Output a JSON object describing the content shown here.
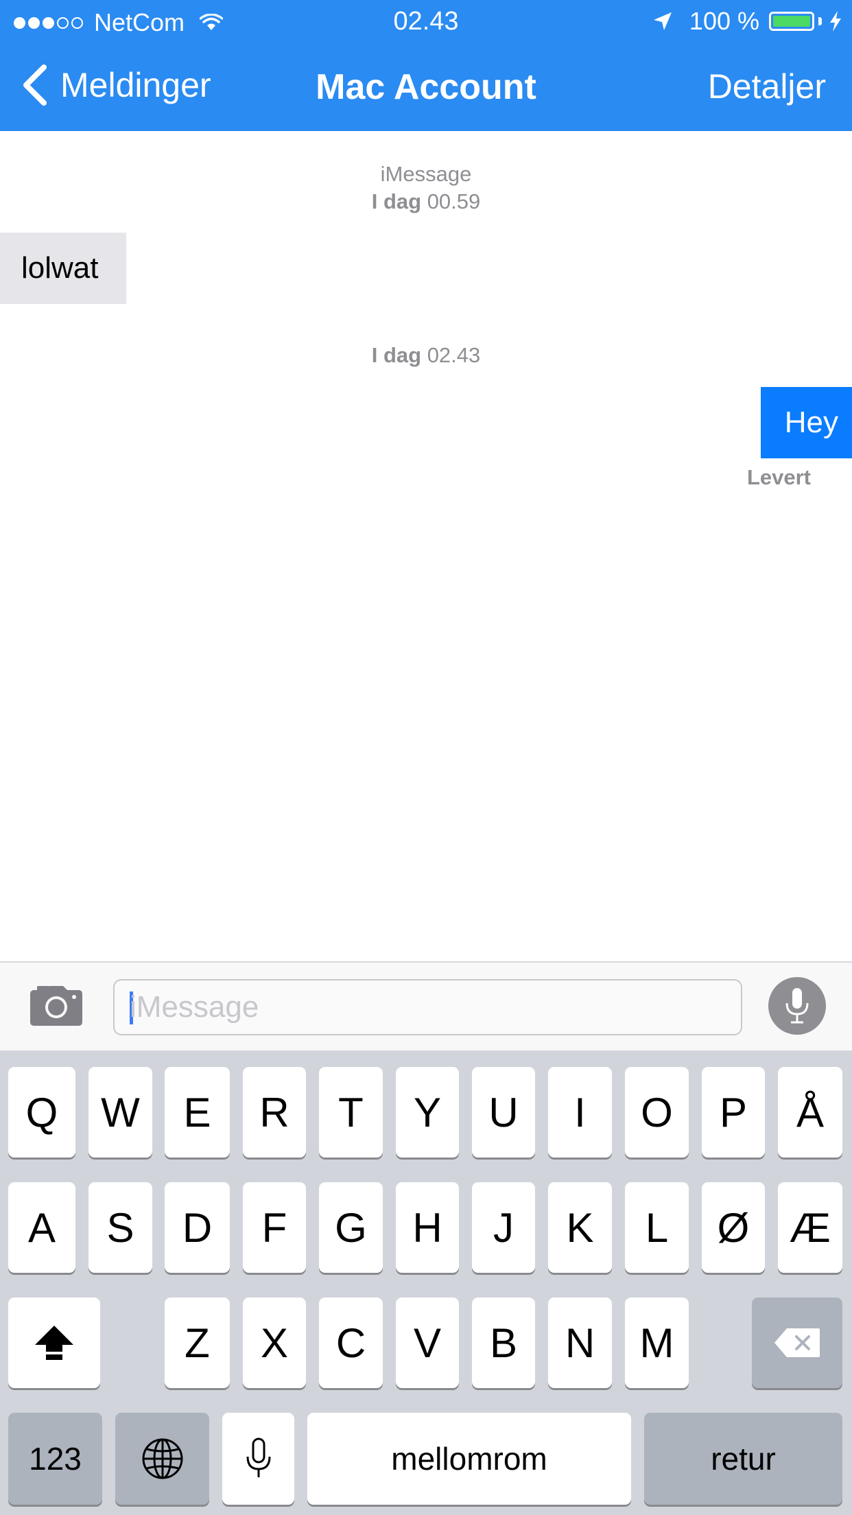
{
  "status_bar": {
    "signal_dots_filled": 3,
    "signal_dots_total": 5,
    "carrier": "NetCom",
    "time": "02.43",
    "battery_percent": "100 %",
    "battery_level": 1.0,
    "wifi_icon": "wifi-icon",
    "location_icon": "location-arrow-icon",
    "charging_icon": "bolt-icon"
  },
  "nav": {
    "back_label": "Meldinger",
    "title": "Mac Account",
    "details_label": "Detaljer"
  },
  "conversation": {
    "header_service": "iMessage",
    "timestamp1_day": "I dag",
    "timestamp1_time": "00.59",
    "incoming_message": "lolwat",
    "timestamp2_day": "I dag",
    "timestamp2_time": "02.43",
    "outgoing_message": "Hey",
    "delivery_status": "Levert"
  },
  "input_bar": {
    "placeholder": "iMessage",
    "value": "",
    "camera_icon": "camera-icon",
    "mic_icon": "microphone-icon"
  },
  "keyboard": {
    "row1": [
      "Q",
      "W",
      "E",
      "R",
      "T",
      "Y",
      "U",
      "I",
      "O",
      "P",
      "Å"
    ],
    "row2": [
      "A",
      "S",
      "D",
      "F",
      "G",
      "H",
      "J",
      "K",
      "L",
      "Ø",
      "Æ"
    ],
    "row3": [
      "Z",
      "X",
      "C",
      "V",
      "B",
      "N",
      "M"
    ],
    "numbers_key": "123",
    "space_key": "mellomrom",
    "return_key": "retur",
    "shift_icon": "shift-arrow-icon",
    "backspace_icon": "backspace-icon",
    "globe_icon": "globe-icon",
    "dictation_icon": "microphone-icon"
  },
  "colors": {
    "header_blue": "#2a8bf2",
    "outgoing_bubble": "#0a7cff",
    "incoming_bubble": "#e5e5ea",
    "battery_green": "#4cd964",
    "keyboard_bg": "#d1d5db"
  }
}
